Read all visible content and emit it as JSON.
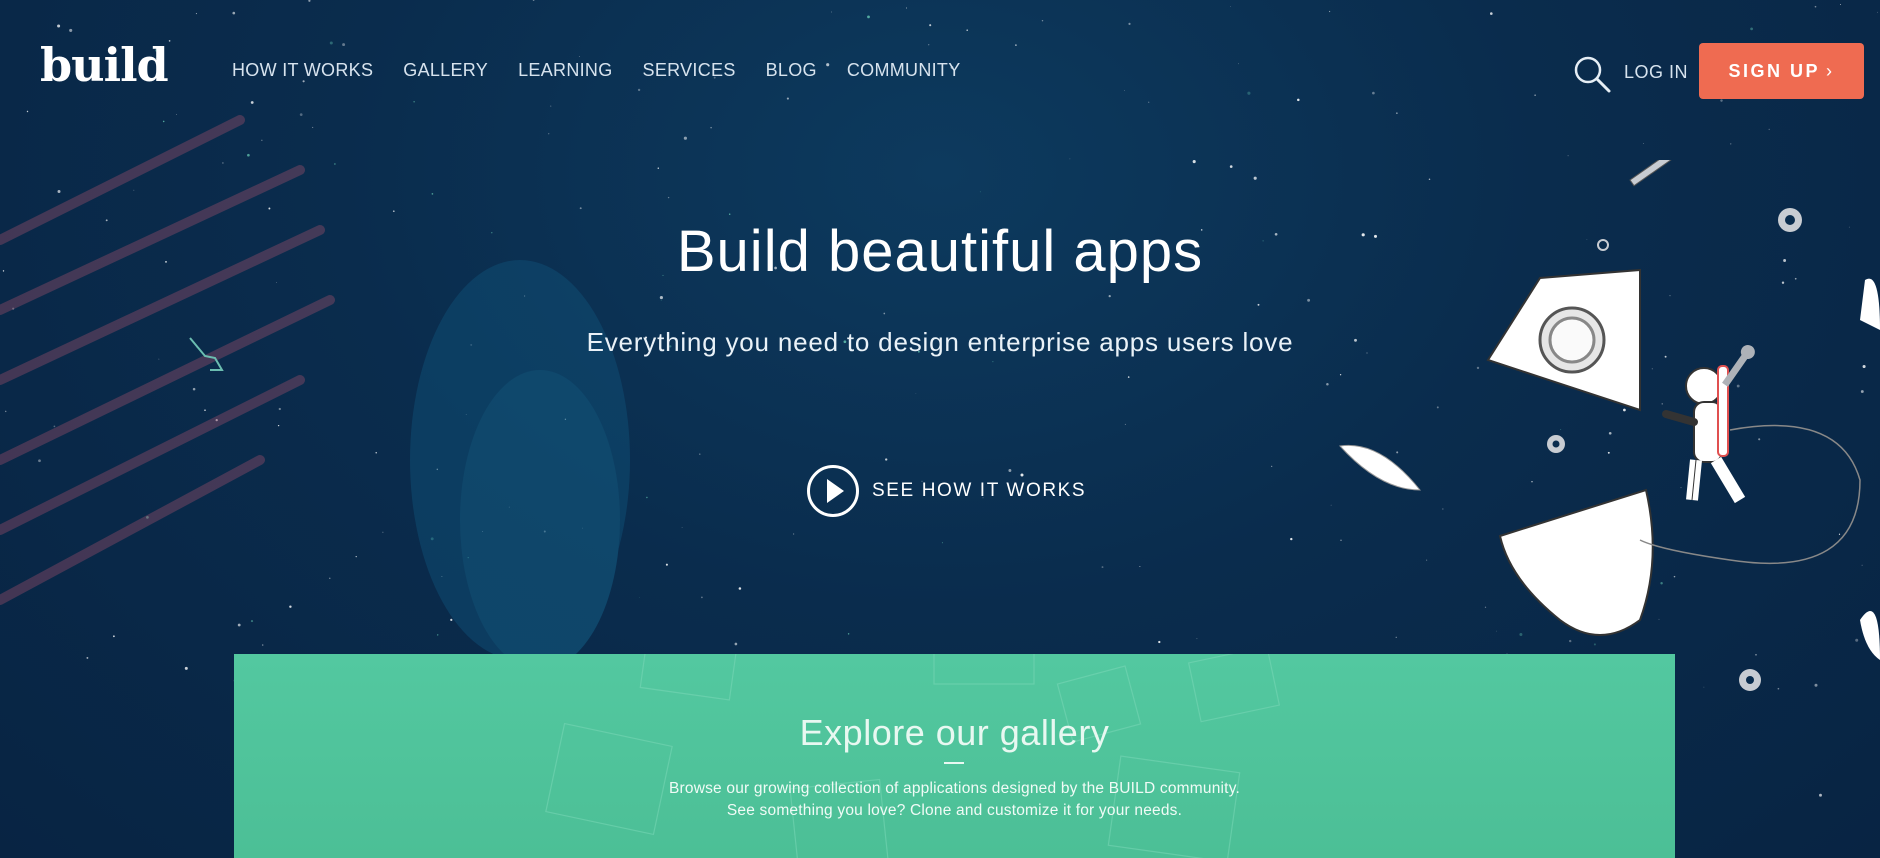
{
  "brand": {
    "logo_text": "build"
  },
  "nav": {
    "items": [
      {
        "label": "HOW IT WORKS"
      },
      {
        "label": "GALLERY"
      },
      {
        "label": "LEARNING"
      },
      {
        "label": "SERVICES"
      },
      {
        "label": "BLOG"
      },
      {
        "label": "COMMUNITY"
      }
    ]
  },
  "header_actions": {
    "search_icon": "search-icon",
    "login_label": "LOG IN",
    "signup_label": "SIGN UP",
    "signup_chevron": "›"
  },
  "hero": {
    "title": "Build beautiful apps",
    "subtitle": "Everything you need to design enterprise apps users love",
    "cta_label": "SEE HOW IT WORKS",
    "cta_icon": "play-icon"
  },
  "gallery": {
    "title": "Explore our gallery",
    "line1": "Browse our growing collection of applications designed by the BUILD community.",
    "line2": "See something you love? Clone and customize it for your needs."
  },
  "colors": {
    "background": "#0a2c4d",
    "accent": "#ef6b51",
    "gallery_green": "#53c8a0",
    "nav_text": "#d7e3ee"
  },
  "illustration": {
    "name": "astronaut-rocket-illustration"
  }
}
